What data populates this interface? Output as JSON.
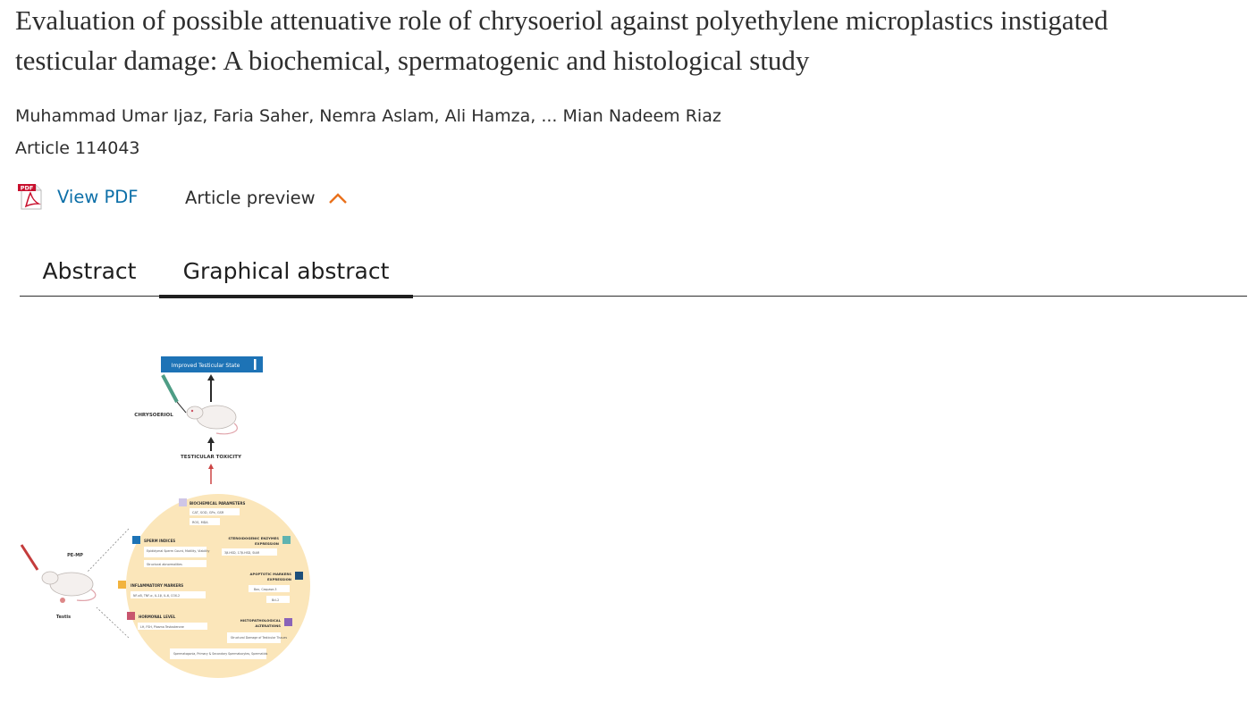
{
  "article": {
    "title_line1": "Evaluation of possible attenuative role of chrysoeriol against polyethylene microplastics instigated",
    "title_line2": "testicular damage: A biochemical, spermatogenic and histological study",
    "authors": "Muhammad Umar Ijaz, Faria Saher, Nemra Aslam, Ali Hamza, ... Mian Nadeem Riaz",
    "article_number": "Article 114043"
  },
  "actions": {
    "view_pdf_label": "View PDF",
    "pdf_icon_text": "PDF",
    "article_preview_label": "Article preview"
  },
  "tabs": [
    {
      "label": "Abstract",
      "active": false
    },
    {
      "label": "Graphical abstract",
      "active": true
    }
  ],
  "graphical_abstract": {
    "top_box": "Improved Testicular State",
    "chrysoeriol_label": "CHRYSOERIOL",
    "toxicity_label": "TESTICULAR TOXICITY",
    "pe_mp_label": "PE-MP",
    "testis_label": "Testis",
    "sections": {
      "biochemical": "BIOCHEMICAL PARAMETERS",
      "biochemical_detail1": "CAT, SOD, GPx, GSR",
      "biochemical_detail2": "ROS, MDA",
      "sperm": "SPERM INDICES",
      "sperm_detail1": "Epididymal Sperm Count, Motility, Viability",
      "sperm_detail2": "Structural abnormalities",
      "steroid_line1": "STEROIDOGENIC ENZYMES",
      "steroid_line2": "EXPRESSION",
      "steroid_detail": "3β-HSD, 17β-HSD, StAR",
      "apoptotic_line1": "APOPTOTIC MARKERS",
      "apoptotic_line2": "EXPRESSION",
      "apoptotic_detail1": "Bax, Caspase-3",
      "apoptotic_detail2": "Bcl-2",
      "inflammatory": "INFLAMMATORY MARKERS",
      "inflammatory_detail": "NF-κB, TNF-α, IL-1β, IL-6, COX-2",
      "hormonal": "HORMONAL LEVEL",
      "hormonal_detail": "LH, FSH, Plasma Testosterone",
      "histo_line1": "HISTOPATHOLOGICAL",
      "histo_line2": "ALTERATIONS",
      "histo_detail1": "Structural Damage of Testicular Tissues",
      "histo_detail2": "Spermatogonia, Primary & Secondary Spermatocytes, Spermatids"
    }
  },
  "colors": {
    "link": "#0c6fa8",
    "accent_orange": "#e9711c",
    "tab_underline": "#1f1f1f",
    "ga_circle": "#fbe6ba",
    "ga_top_box": "#1d73b6"
  }
}
